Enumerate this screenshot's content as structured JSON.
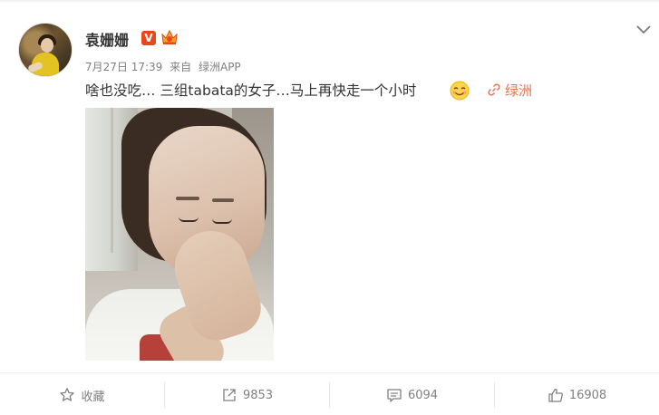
{
  "post": {
    "username": "袁姗姗",
    "vip_badge": "V",
    "timestamp": "7月27日 17:39",
    "source_prefix": "来自",
    "source": "绿洲APP",
    "text": "啥也没吃… 三组tabata的女子…马上再快走一个小时",
    "topic_link": "绿洲"
  },
  "actions": {
    "favorite": {
      "label": "收藏",
      "icon": "star-icon"
    },
    "repost": {
      "count": "9853",
      "icon": "share-icon"
    },
    "comment": {
      "count": "6094",
      "icon": "comment-icon"
    },
    "like": {
      "count": "16908",
      "icon": "thumbs-up-icon"
    }
  },
  "colors": {
    "link": "#eb7350",
    "badge": "#e8471b",
    "muted": "#808080"
  }
}
